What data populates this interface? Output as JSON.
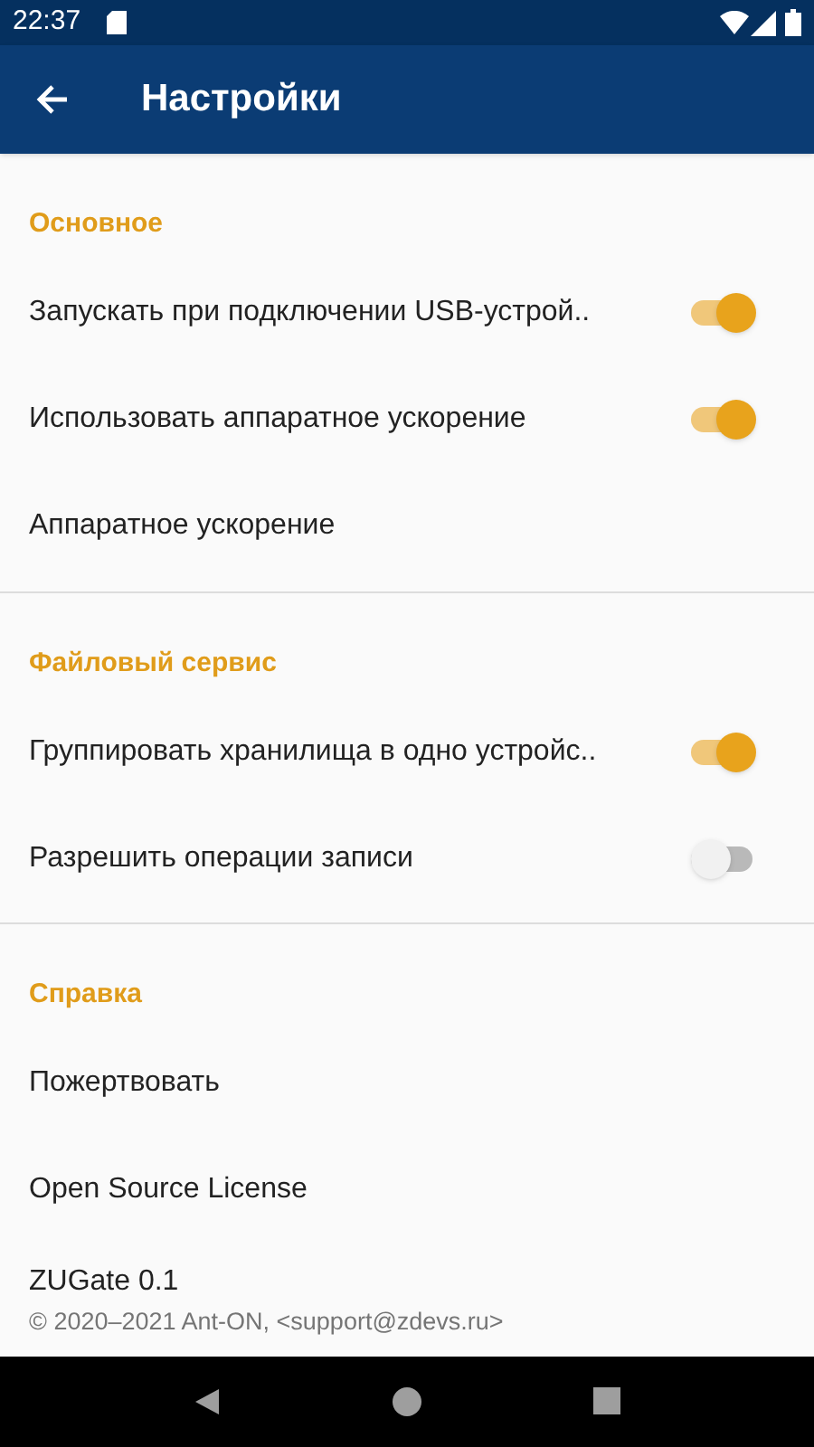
{
  "status_bar": {
    "time": "22:37"
  },
  "app_bar": {
    "title": "Настройки"
  },
  "sections": [
    {
      "title": "Основное",
      "items": [
        {
          "kind": "switch",
          "label": "Запускать при подключении USB-устрой..",
          "on": true
        },
        {
          "kind": "switch",
          "label": "Использовать аппаратное ускорение",
          "on": true
        },
        {
          "kind": "plain",
          "label": "Аппаратное ускорение"
        }
      ]
    },
    {
      "title": "Файловый сервис",
      "items": [
        {
          "kind": "switch",
          "label": "Группировать хранилища в одно устройс..",
          "on": true
        },
        {
          "kind": "switch",
          "label": "Разрешить операции записи",
          "on": false
        }
      ]
    },
    {
      "title": "Справка",
      "items": [
        {
          "kind": "plain",
          "label": "Пожертвовать"
        },
        {
          "kind": "plain",
          "label": "Open Source License"
        },
        {
          "kind": "info",
          "label": "ZUGate 0.1",
          "summary": "© 2020–2021 Ant-ON, <support@zdevs.ru>"
        }
      ]
    }
  ]
}
